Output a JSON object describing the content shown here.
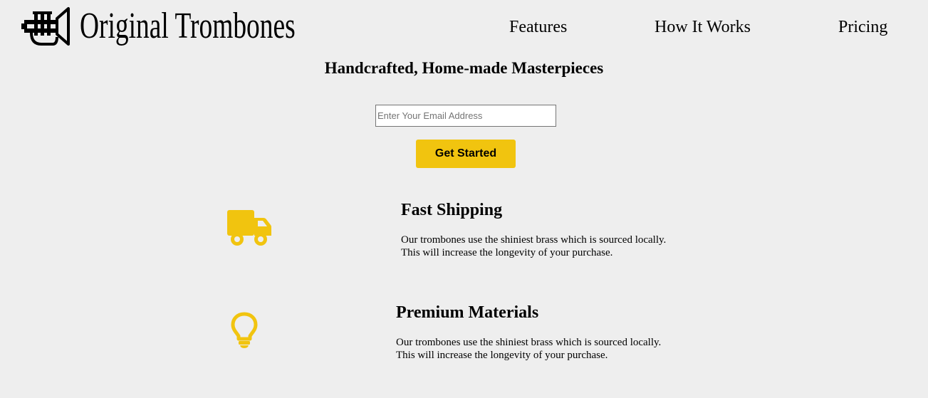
{
  "header": {
    "logo_text": "Original Trombones",
    "logo_icon": "trumpet-icon",
    "nav": [
      {
        "label": "Features"
      },
      {
        "label": "How It Works"
      },
      {
        "label": "Pricing"
      }
    ]
  },
  "hero": {
    "title": "Handcrafted, Home-made Masterpieces",
    "email_placeholder": "Enter Your Email Address",
    "email_value": "",
    "cta_label": "Get Started"
  },
  "features": [
    {
      "icon": "truck-icon",
      "title": "Fast Shipping",
      "desc_line1": "Our trombones use the shiniest brass which is sourced locally.",
      "desc_line2": "This will increase the longevity of your purchase."
    },
    {
      "icon": "lightbulb-icon",
      "title": "Premium Materials",
      "desc_line1": "Our trombones use the shiniest brass which is sourced locally.",
      "desc_line2": "This will increase the longevity of your purchase."
    }
  ],
  "colors": {
    "accent": "#f1c40f",
    "background": "#eeeeee",
    "text": "#000000"
  }
}
